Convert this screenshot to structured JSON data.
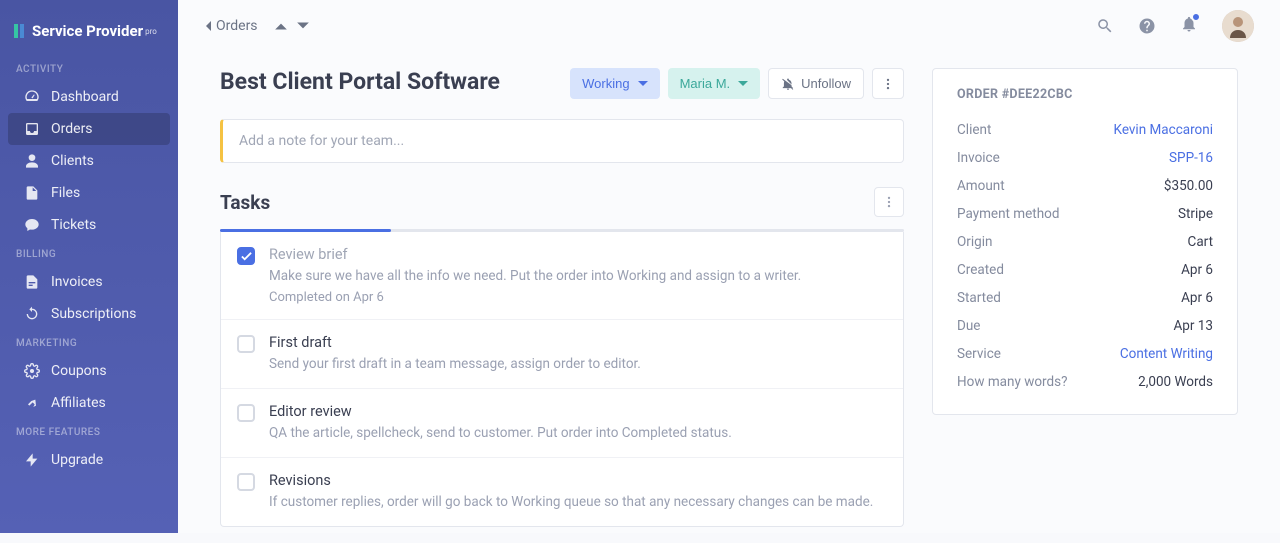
{
  "brand": {
    "name": "Service Provider",
    "suffix": "pro"
  },
  "sidebar": {
    "sections": {
      "activity_label": "ACTIVITY",
      "billing_label": "BILLING",
      "marketing_label": "MARKETING",
      "more_label": "MORE FEATURES"
    },
    "items": {
      "dashboard": "Dashboard",
      "orders": "Orders",
      "clients": "Clients",
      "files": "Files",
      "tickets": "Tickets",
      "invoices": "Invoices",
      "subscriptions": "Subscriptions",
      "coupons": "Coupons",
      "affiliates": "Affiliates",
      "upgrade": "Upgrade"
    }
  },
  "breadcrumb": {
    "back": "Orders"
  },
  "page": {
    "title": "Best Client Portal Software"
  },
  "status": {
    "working": "Working",
    "assignee": "Maria M."
  },
  "unfollow_label": "Unfollow",
  "note": {
    "placeholder": "Add a note for your team..."
  },
  "tasks": {
    "heading": "Tasks",
    "items": [
      {
        "title": "Review brief",
        "desc": "Make sure we have all the info we need. Put the order into Working and assign to a writer.",
        "meta": "Completed on Apr 6",
        "done": true
      },
      {
        "title": "First draft",
        "desc": "Send your first draft in a team message, assign order to editor."
      },
      {
        "title": "Editor review",
        "desc": "QA the article, spellcheck, send to customer. Put order into Completed status."
      },
      {
        "title": "Revisions",
        "desc": "If customer replies, order will go back to Working queue so that any necessary changes can be made."
      }
    ]
  },
  "order": {
    "header": "ORDER #DEE22CBC",
    "rows": [
      {
        "label": "Client",
        "value": "Kevin Maccaroni",
        "link": true
      },
      {
        "label": "Invoice",
        "value": "SPP-16",
        "link": true
      },
      {
        "label": "Amount",
        "value": "$350.00"
      },
      {
        "label": "Payment method",
        "value": "Stripe"
      },
      {
        "label": "Origin",
        "value": "Cart"
      },
      {
        "label": "Created",
        "value": "Apr 6"
      },
      {
        "label": "Started",
        "value": "Apr 6"
      },
      {
        "label": "Due",
        "value": "Apr 13"
      },
      {
        "label": "Service",
        "value": "Content Writing",
        "link": true
      },
      {
        "label": "How many words?",
        "value": "2,000 Words"
      }
    ]
  }
}
